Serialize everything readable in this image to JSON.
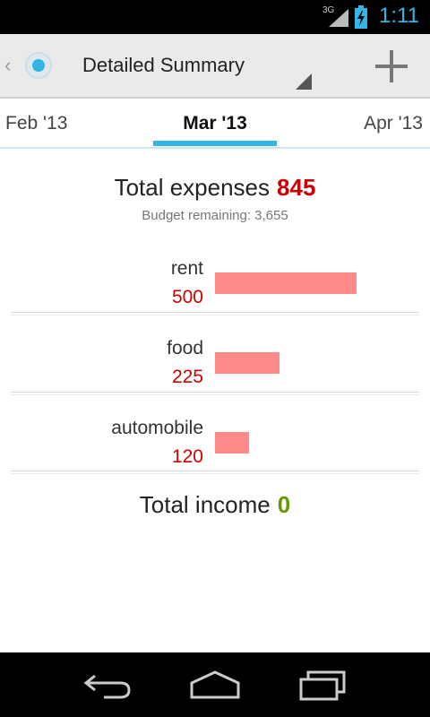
{
  "status_bar": {
    "network": "3G",
    "time": "1:11"
  },
  "action_bar": {
    "title": "Detailed Summary",
    "add_icon": "plus-icon",
    "app_icon": "app-icon"
  },
  "tabs": {
    "prev": "Feb '13",
    "current": "Mar '13",
    "next": "Apr '13"
  },
  "summary": {
    "total_expenses_label": "Total expenses",
    "total_expenses_value": "845",
    "budget_remaining": "Budget remaining:  3,655",
    "categories": [
      {
        "name": "rent",
        "amount": "500",
        "fraction": 0.33
      },
      {
        "name": "food",
        "amount": "225",
        "fraction": 0.15
      },
      {
        "name": "automobile",
        "amount": "120",
        "fraction": 0.08
      }
    ],
    "total_income_label": "Total income",
    "total_income_value": "0"
  },
  "colors": {
    "accent": "#33b5e5",
    "expense_red": "#cc0000",
    "income_green": "#669900",
    "bar_fill": "#ff8a8a"
  },
  "nav_bar": {
    "back_icon": "back-icon",
    "home_icon": "home-icon",
    "recents_icon": "recents-icon"
  }
}
